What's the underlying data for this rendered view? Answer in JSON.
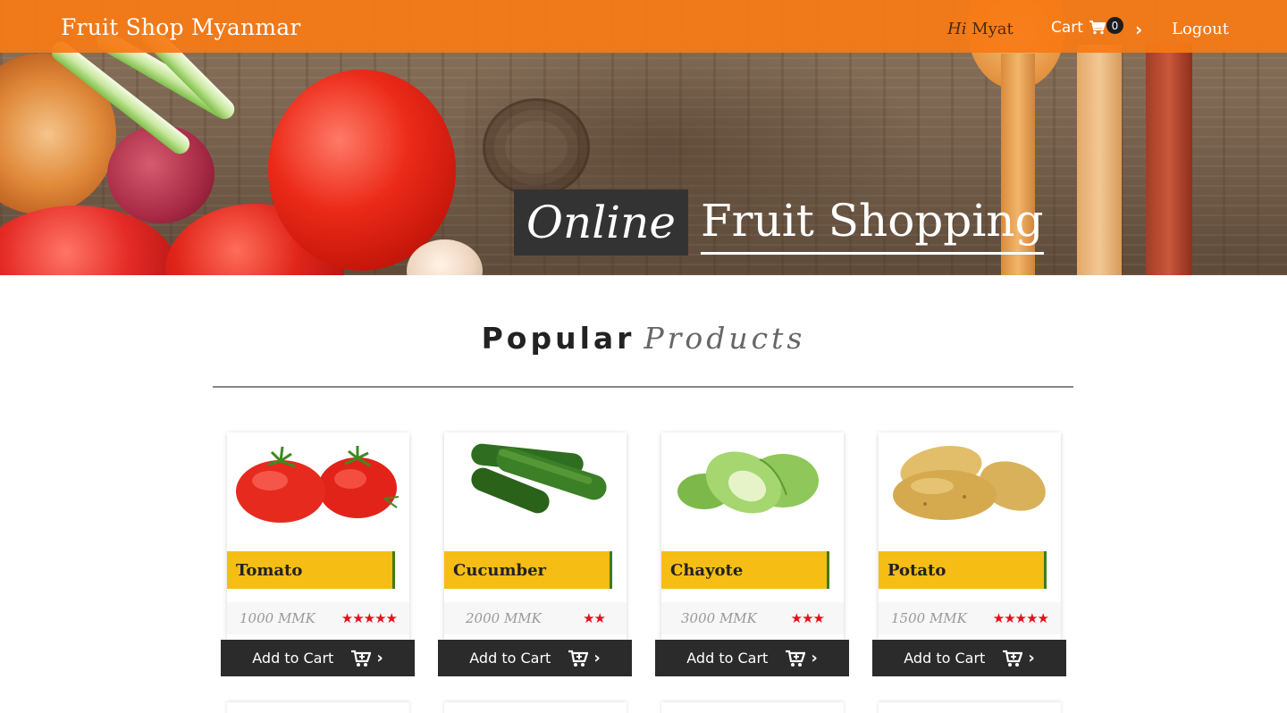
{
  "navbar": {
    "brand": "Fruit Shop Myanmar",
    "greeting_prefix": "Hi",
    "greeting_name": "Myat",
    "cart_label": "Cart",
    "cart_count": "0",
    "chevron": "›",
    "logout_label": "Logout"
  },
  "hero": {
    "title_highlight": "Online",
    "title_rest": "Fruit Shopping"
  },
  "section": {
    "title_bold": "Popular",
    "title_italic": "Products"
  },
  "products": [
    {
      "name": "Tomato",
      "price": "1000 MMK",
      "stars": "★★★★★",
      "rating": 5,
      "button": "Add to Cart"
    },
    {
      "name": "Cucumber",
      "price": "2000 MMK",
      "stars": "★★",
      "rating": 2,
      "button": "Add to Cart"
    },
    {
      "name": "Chayote",
      "price": "3000 MMK",
      "stars": "★★★",
      "rating": 3,
      "button": "Add to Cart"
    },
    {
      "name": "Potato",
      "price": "1500 MMK",
      "stars": "★★★★★",
      "rating": 5,
      "button": "Add to Cart"
    }
  ],
  "colors": {
    "navbar": "#f77a14",
    "name_bar": "#f6bd14",
    "star": "#e3101b",
    "button": "#2b2b2b"
  },
  "icons": {
    "cart": "shopping-cart-icon",
    "add_to_cart": "cart-plus-icon",
    "chevron": "chevron-right-icon"
  }
}
